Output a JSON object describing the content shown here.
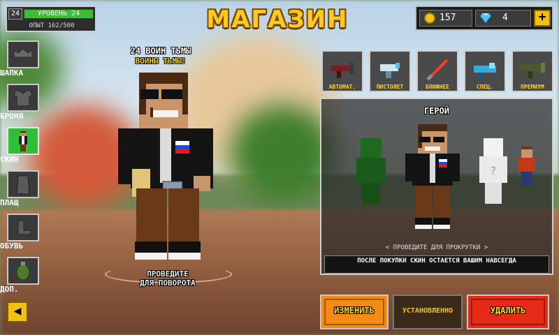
{
  "header": {
    "title": "МАГАЗИН",
    "level": {
      "badge": "24",
      "label": "УРОВЕНЬ 24",
      "xp": "ОПЫТ 162/500"
    },
    "currency": {
      "coins": "157",
      "gems": "4",
      "coin_icon": "coin-icon",
      "gem_icon": "diamond-icon",
      "add_icon": "plus-icon"
    }
  },
  "categories": [
    {
      "label": "ШАПКА",
      "icon": "hat-icon",
      "active": false
    },
    {
      "label": "БРОНЯ",
      "icon": "armor-icon",
      "active": false
    },
    {
      "label": "СКИН",
      "icon": "skin-icon",
      "active": true
    },
    {
      "label": "ПЛАЩ",
      "icon": "cape-icon",
      "active": false
    },
    {
      "label": "ОБУВЬ",
      "icon": "boots-icon",
      "active": false
    },
    {
      "label": "ДОП.",
      "icon": "grenade-icon",
      "active": false
    }
  ],
  "player": {
    "name": "24 ВОИН ТЬМЫ",
    "clan": "ВОИНЫ ТЬМЫ!",
    "rotate_hint_line1": "ПРОВЕДИТЕ",
    "rotate_hint_line2": "ДЛЯ ПОВОРОТА"
  },
  "weapon_tabs": [
    {
      "label": "АВТОМАТ.",
      "icon": "assault-rifle-icon"
    },
    {
      "label": "ПИСТОЛЕТ",
      "icon": "pistol-icon"
    },
    {
      "label": "БЛИЖНЕЕ",
      "icon": "lightsaber-icon"
    },
    {
      "label": "СПЕЦ.",
      "icon": "special-weapon-icon"
    },
    {
      "label": "ПРЕМИУМ",
      "icon": "rocket-launcher-icon"
    }
  ],
  "skins_panel": {
    "title": "ГЕРОЙ",
    "scroll_hint": "< ПРОВЕДИТЕ ДЛЯ ПРОКРУТКИ >",
    "info": "ПОСЛЕ ПОКУПКИ СКИН ОСТАЕТСЯ ВАШИМ НАВСЕГДА"
  },
  "buttons": {
    "change": "ИЗМЕНИТЬ",
    "status": "УСТАНОВЛЕННО",
    "delete": "УДАЛИТЬ",
    "back_icon": "arrow-left-icon"
  },
  "colors": {
    "accent_yellow": "#ffc822",
    "active_green": "#2fbf37",
    "change_orange": "#f58a14",
    "delete_red": "#e52a18"
  }
}
